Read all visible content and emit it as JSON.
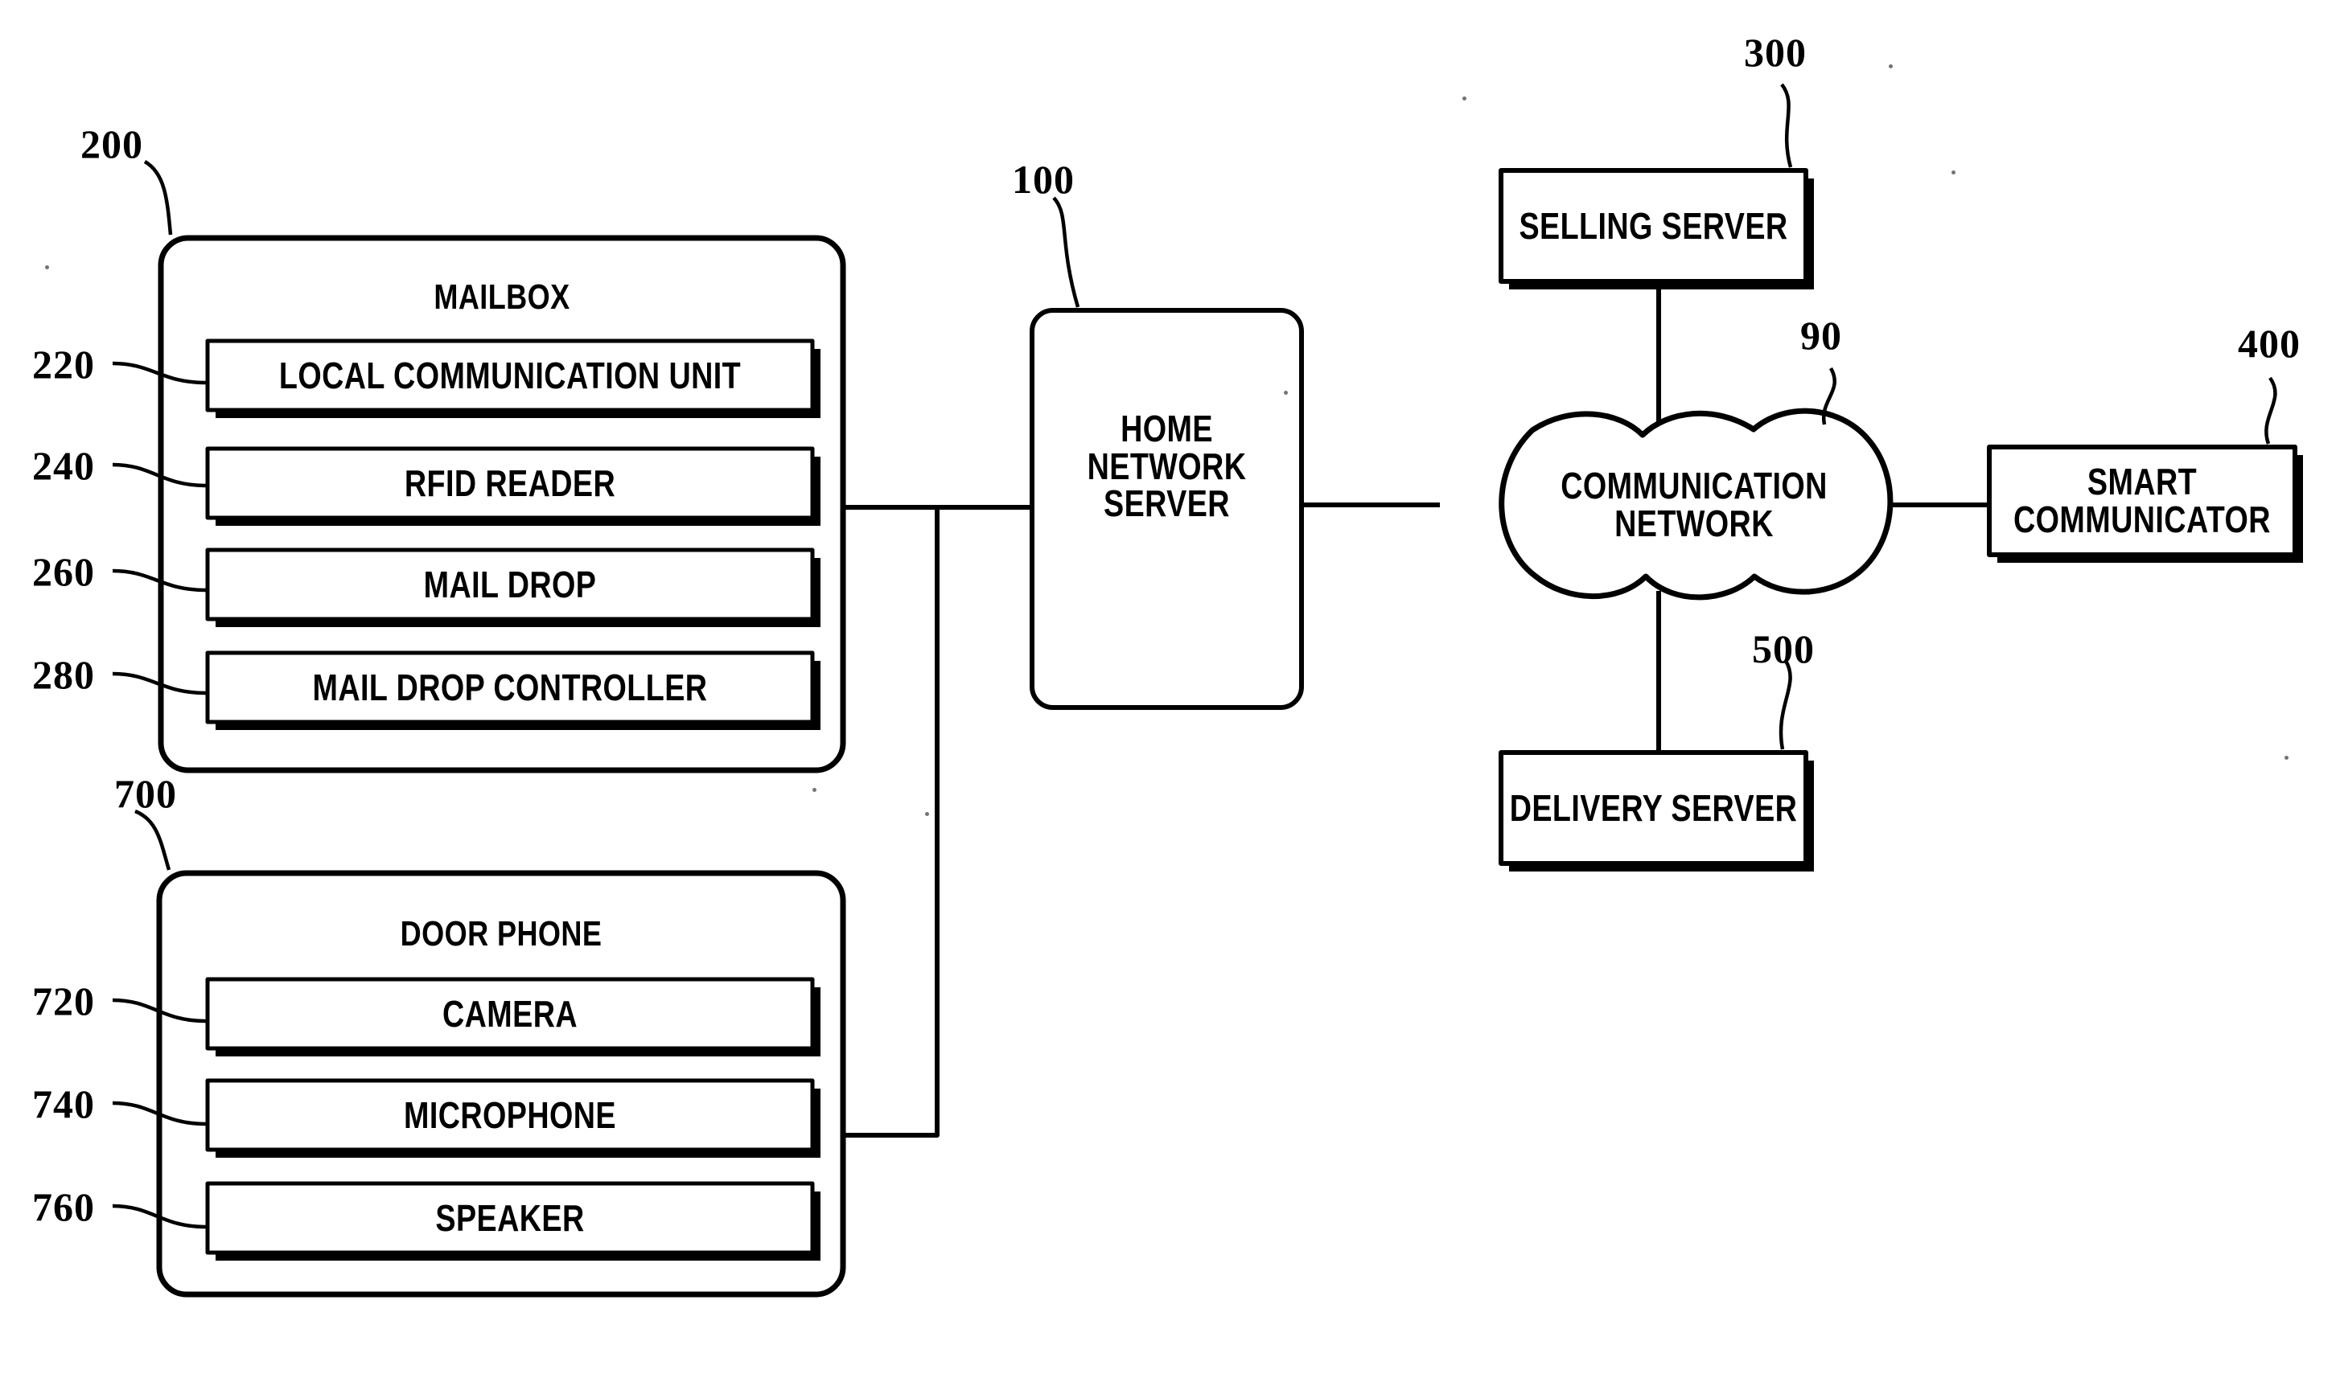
{
  "figure": {
    "type": "patent-block-diagram",
    "groups": [
      {
        "ref": "200",
        "title": "MAILBOX",
        "modules": [
          {
            "ref": "220",
            "label": "LOCAL COMMUNICATION UNIT"
          },
          {
            "ref": "240",
            "label": "RFID READER"
          },
          {
            "ref": "260",
            "label": "MAIL DROP"
          },
          {
            "ref": "280",
            "label": "MAIL DROP CONTROLLER"
          }
        ]
      },
      {
        "ref": "700",
        "title": "DOOR PHONE",
        "modules": [
          {
            "ref": "720",
            "label": "CAMERA"
          },
          {
            "ref": "740",
            "label": "MICROPHONE"
          },
          {
            "ref": "760",
            "label": "SPEAKER"
          }
        ]
      }
    ],
    "nodes": [
      {
        "ref": "100",
        "label": "HOME\nNETWORK\nSERVER",
        "shape": "rounded-rect"
      },
      {
        "ref": "300",
        "label": "SELLING SERVER",
        "shape": "rect"
      },
      {
        "ref": "90",
        "label": "COMMUNICATION\nNETWORK",
        "shape": "cloud"
      },
      {
        "ref": "400",
        "label": "SMART\nCOMMUNICATOR",
        "shape": "rect"
      },
      {
        "ref": "500",
        "label": "DELIVERY SERVER",
        "shape": "rect"
      }
    ],
    "links": [
      {
        "from": "200",
        "to": "100"
      },
      {
        "from": "700",
        "to": "100"
      },
      {
        "from": "100",
        "to": "90"
      },
      {
        "from": "300",
        "to": "90"
      },
      {
        "from": "500",
        "to": "90"
      },
      {
        "from": "90",
        "to": "400"
      }
    ],
    "colors": {
      "ink": "#000000",
      "paper": "#ffffff"
    }
  }
}
